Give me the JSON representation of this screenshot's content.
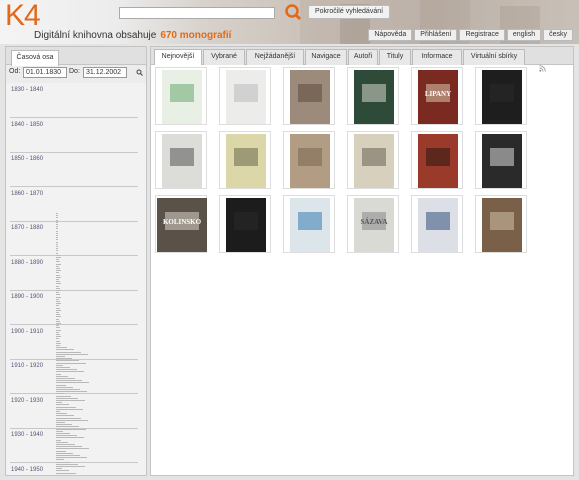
{
  "header": {
    "logo": "K4",
    "subtitle": "Digitální knihovna obsahuje",
    "count": "670 monografií",
    "search_placeholder": "",
    "advanced_search": "Pokročilé vyhledávání",
    "nav": [
      "Nápověda",
      "Přihlášení",
      "Registrace",
      "english",
      "česky"
    ]
  },
  "timeline": {
    "tab": "Časová osa",
    "from_label": "Od:",
    "from_value": "01.01.1830",
    "to_label": "Do:",
    "to_value": "31.12.2002",
    "decades": [
      "1830 - 1840",
      "1840 - 1850",
      "1850 - 1860",
      "1860 - 1870",
      "1870 - 1880",
      "1880 - 1890",
      "1890 - 1900",
      "1900 - 1910",
      "1910 - 1920",
      "1920 - 1930",
      "1930 - 1940",
      "1940 - 1950"
    ]
  },
  "main": {
    "tabs": [
      "Nejnovější",
      "Vybrané",
      "Nejžádanější",
      "Navigace",
      "Autoři",
      "Tituly",
      "Informace",
      "Virtuální sbírky"
    ],
    "active_tab": "Nejnovější",
    "covers": [
      {
        "color": "#e8efe4",
        "accent": "#6aa870",
        "text": ""
      },
      {
        "color": "#ececea",
        "accent": "#bbbbbb",
        "text": ""
      },
      {
        "color": "#9c8a7a",
        "accent": "#5e4b3e",
        "text": ""
      },
      {
        "color": "#2e4b3a",
        "accent": "#d6d6c8",
        "text": ""
      },
      {
        "color": "#7a2a20",
        "accent": "#d8c8b0",
        "text": "LIPANY"
      },
      {
        "color": "#1e1e1e",
        "accent": "#2a2a2a",
        "text": ""
      },
      {
        "color": "#dcdcd8",
        "accent": "#555555",
        "text": ""
      },
      {
        "color": "#dcd7a8",
        "accent": "#6a6a4a",
        "text": ""
      },
      {
        "color": "#b29c84",
        "accent": "#7a6652",
        "text": ""
      },
      {
        "color": "#d7d0bc",
        "accent": "#6a6258",
        "text": ""
      },
      {
        "color": "#9a3a2a",
        "accent": "#2a1a14",
        "text": ""
      },
      {
        "color": "#2a2a2a",
        "accent": "#d8d8d8",
        "text": ""
      },
      {
        "color": "#5a5248",
        "accent": "#d8d2c8",
        "text": "KOLINSKO"
      },
      {
        "color": "#1c1c1c",
        "accent": "#2a2a2a",
        "text": ""
      },
      {
        "color": "#dce6ea",
        "accent": "#3a7ab0",
        "text": ""
      },
      {
        "color": "#dadad4",
        "accent": "#888888",
        "text": "SÁZAVA"
      },
      {
        "color": "#dcdfe6",
        "accent": "#33507a",
        "text": ""
      },
      {
        "color": "#7a6048",
        "accent": "#d0c0a8",
        "text": ""
      }
    ]
  },
  "colors": {
    "accent": "#e06a1a"
  }
}
